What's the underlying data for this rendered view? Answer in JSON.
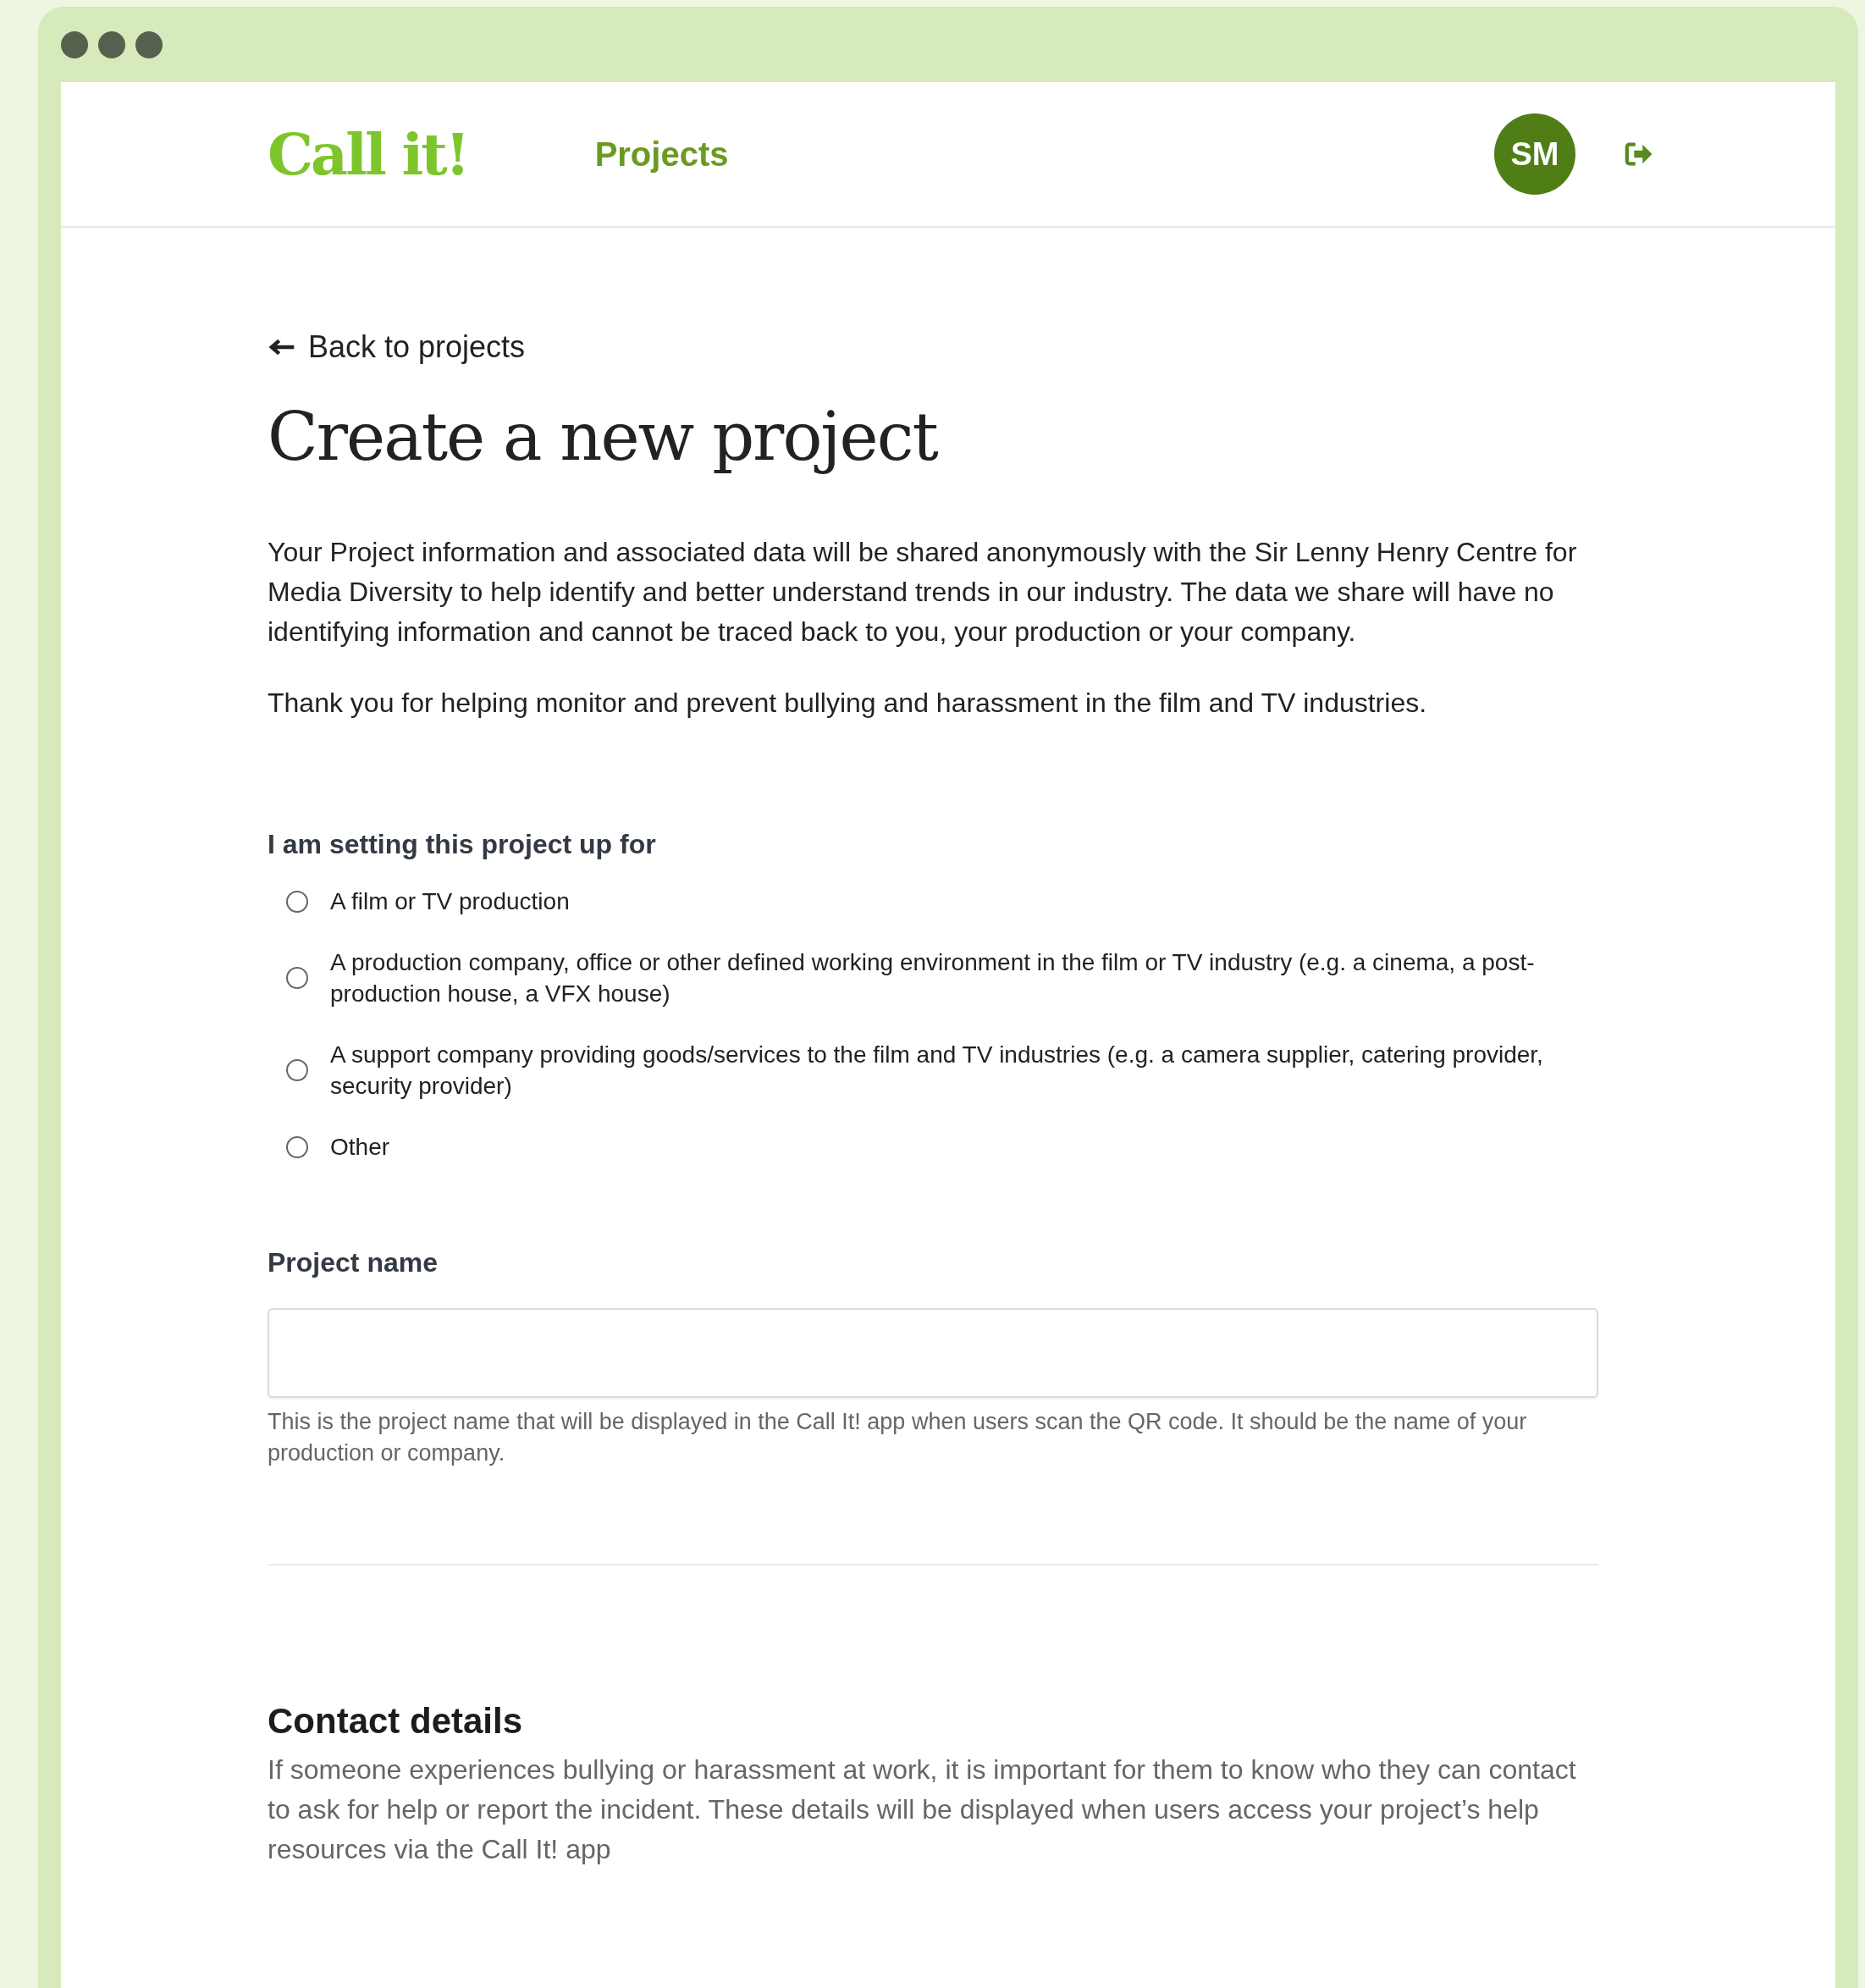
{
  "header": {
    "logo": "Call it!",
    "nav": [
      "Projects"
    ],
    "avatar": "SM"
  },
  "back_link": "Back to projects",
  "title": "Create a new project",
  "intro": [
    "Your Project information and associated data will be shared anonymously with the Sir Lenny Henry Centre for Media Diversity to help identify and better understand trends in our industry. The data we share will have no identifying information and cannot be traced back to you, your production or your company.",
    "Thank you for helping monitor and prevent bullying and harassment in the film and TV industries."
  ],
  "setup_for": {
    "label": "I am setting this project up for",
    "options": [
      {
        "label": "A film or TV production",
        "selected": false
      },
      {
        "label": "A production company, office or other defined working environment in the film or TV industry (e.g. a cinema, a post-production house, a VFX house)",
        "selected": false
      },
      {
        "label": "A support company providing goods/services to the film and TV industries (e.g. a camera supplier, catering provider, security provider)",
        "selected": false
      },
      {
        "label": "Other",
        "selected": false
      }
    ]
  },
  "project_name": {
    "label": "Project name",
    "help": "This is the project name that will be displayed in the Call It! app when users scan the QR code. It should be the name of your production or company."
  },
  "contact": {
    "title": "Contact details",
    "text": "If someone experiences bullying or harassment at work, it is important for them to know who they can contact to ask for help or report the incident. These details will be displayed when users access your project’s help resources via the Call It! app"
  }
}
